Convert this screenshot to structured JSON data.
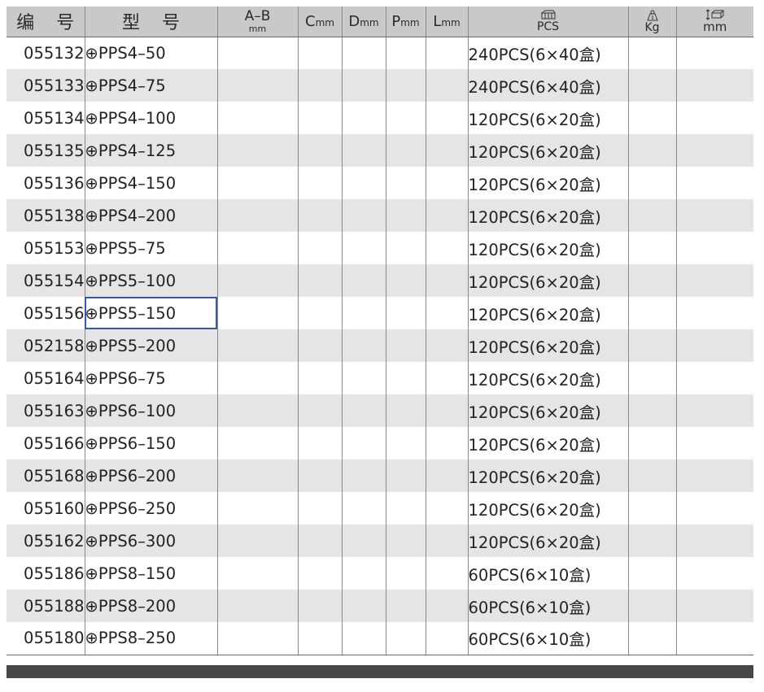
{
  "header": {
    "code": "编 号",
    "model": "型 号",
    "ab_top": "A–B",
    "ab_sub": "mm",
    "c_letter": "C",
    "d_letter": "D",
    "p_letter": "P",
    "l_letter": "L",
    "unit": "mm",
    "pcs": "PCS",
    "kg": "Kg",
    "size_mm": "mm",
    "pack_icon": "box-icon",
    "weight_icon": "weight-icon",
    "size_icon": "carton-size-icon"
  },
  "rows": [
    {
      "code": "055132",
      "model": "⊕PPS4–50",
      "pack": "240PCS(6×40盒)"
    },
    {
      "code": "055133",
      "model": "⊕PPS4–75",
      "pack": "240PCS(6×40盒)"
    },
    {
      "code": "055134",
      "model": "⊕PPS4–100",
      "pack": "120PCS(6×20盒)"
    },
    {
      "code": "055135",
      "model": "⊕PPS4–125",
      "pack": "120PCS(6×20盒)"
    },
    {
      "code": "055136",
      "model": "⊕PPS4–150",
      "pack": "120PCS(6×20盒)"
    },
    {
      "code": "055138",
      "model": "⊕PPS4–200",
      "pack": "120PCS(6×20盒)"
    },
    {
      "code": "055153",
      "model": "⊕PPS5–75",
      "pack": "120PCS(6×20盒)"
    },
    {
      "code": "055154",
      "model": "⊕PPS5–100",
      "pack": "120PCS(6×20盒)"
    },
    {
      "code": "055156",
      "model": "⊕PPS5–150",
      "pack": "120PCS(6×20盒)"
    },
    {
      "code": "052158",
      "model": "⊕PPS5–200",
      "pack": "120PCS(6×20盒)"
    },
    {
      "code": "055164",
      "model": "⊕PPS6–75",
      "pack": "120PCS(6×20盒)"
    },
    {
      "code": "055163",
      "model": "⊕PPS6–100",
      "pack": "120PCS(6×20盒)"
    },
    {
      "code": "055166",
      "model": "⊕PPS6–150",
      "pack": "120PCS(6×20盒)"
    },
    {
      "code": "055168",
      "model": "⊕PPS6–200",
      "pack": "120PCS(6×20盒)"
    },
    {
      "code": "055160",
      "model": "⊕PPS6–250",
      "pack": "120PCS(6×20盒)"
    },
    {
      "code": "055162",
      "model": "⊕PPS6–300",
      "pack": "120PCS(6×20盒)"
    },
    {
      "code": "055186",
      "model": "⊕PPS8–150",
      "pack": "60PCS(6×10盒)"
    },
    {
      "code": "055188",
      "model": "⊕PPS8–200",
      "pack": "60PCS(6×10盒)"
    },
    {
      "code": "055180",
      "model": "⊕PPS8–250",
      "pack": "60PCS(6×10盒)"
    }
  ],
  "colors": {
    "header_bg": "#c9c9c9",
    "stripe_bg": "#e5e5e5",
    "selection_border": "#3458b4",
    "footer_bar": "#474747"
  },
  "selection": {
    "row": 8,
    "column": "model"
  }
}
